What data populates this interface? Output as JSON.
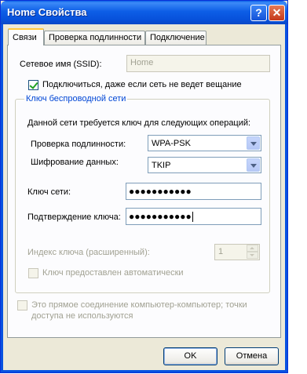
{
  "window": {
    "title": "Home Свойства",
    "help_glyph": "?",
    "close_glyph": "✕"
  },
  "tabs": [
    {
      "label": "Связи"
    },
    {
      "label": "Проверка подлинности"
    },
    {
      "label": "Подключение"
    }
  ],
  "ssid": {
    "label": "Сетевое имя (SSID):",
    "value": "Home"
  },
  "broadcast": {
    "label": "Подключиться, даже если сеть не ведет вещание",
    "checked": true
  },
  "wireless_key": {
    "group_title": "Ключ беспроводной сети",
    "info_text": "Данной сети требуется ключ для следующих операций:",
    "auth_label": "Проверка подлинности:",
    "auth_value": "WPA-PSK",
    "encryption_label": "Шифрование данных:",
    "encryption_value": "TKIP",
    "key_label": "Ключ сети:",
    "key_value": "●●●●●●●●●●●",
    "confirm_label": "Подтверждение ключа:",
    "confirm_value": "●●●●●●●●●●●",
    "index_label": "Индекс ключа (расширенный):",
    "index_value": "1",
    "auto_key_label": "Ключ предоставлен автоматически",
    "auto_key_checked": false
  },
  "adhoc": {
    "label": "Это прямое соединение компьютер-компьютер; точки доступа не используются",
    "checked": false
  },
  "buttons": {
    "ok": "OK",
    "cancel": "Отмена"
  },
  "colors": {
    "titlebar": "#0a5fe6",
    "group_title": "#0046d5",
    "tab_highlight": "#ffc83c"
  }
}
